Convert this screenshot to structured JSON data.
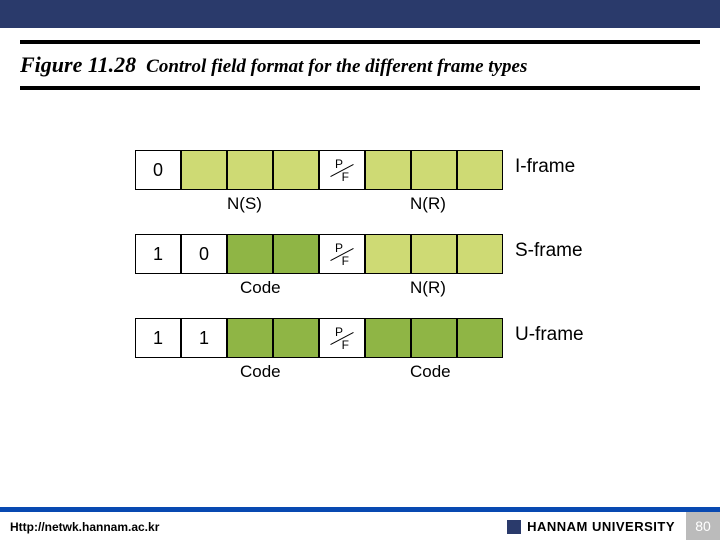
{
  "header": {
    "figure_label": "Figure 11.28",
    "caption": "Control field format for the different frame types"
  },
  "frames": {
    "iframe": {
      "bit0": "0",
      "pf": "P/F",
      "label": "I-frame",
      "under_left": "N(S)",
      "under_right": "N(R)"
    },
    "sframe": {
      "bit0": "1",
      "bit1": "0",
      "pf": "P/F",
      "label": "S-frame",
      "under_left": "Code",
      "under_right": "N(R)"
    },
    "uframe": {
      "bit0": "1",
      "bit1": "1",
      "pf": "P/F",
      "label": "U-frame",
      "under_left": "Code",
      "under_right": "Code"
    }
  },
  "footer": {
    "url": "Http://netwk.hannam.ac.kr",
    "university": "HANNAM  UNIVERSITY",
    "page": "80"
  }
}
